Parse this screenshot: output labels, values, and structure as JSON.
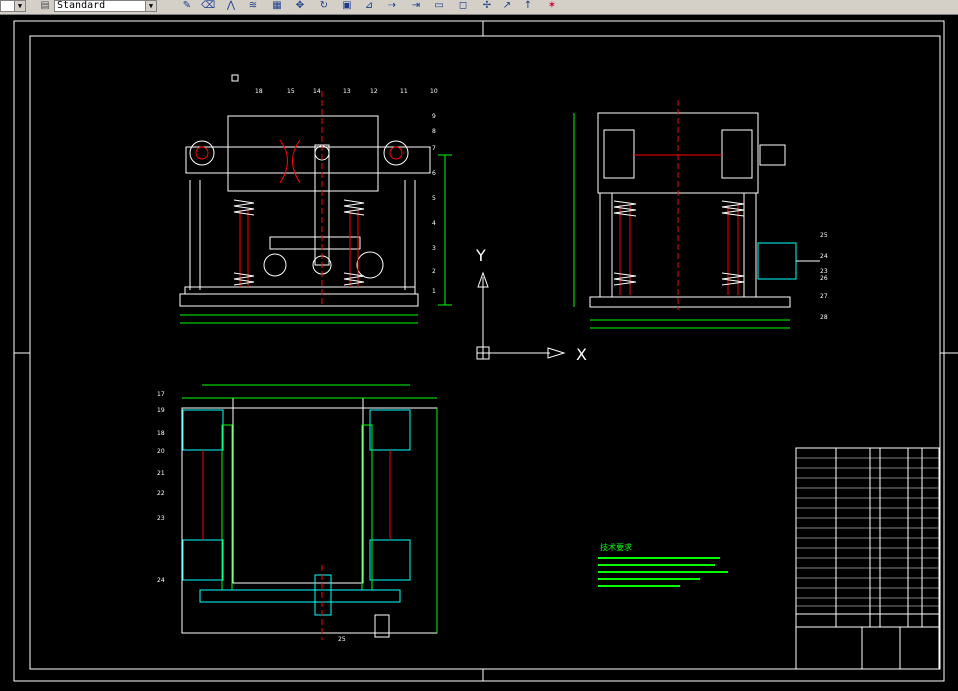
{
  "toolbar": {
    "text_style": "Standard",
    "layer_value": "",
    "icons": [
      "pencil-icon",
      "eraser-icon",
      "mirror-icon",
      "offset-icon",
      "array-icon",
      "move-icon",
      "rotate-icon",
      "scale-icon",
      "stretch-icon",
      "trim-icon",
      "extend-icon",
      "break-icon",
      "chamfer-icon",
      "fillet-icon",
      "explode-icon"
    ]
  },
  "ucs": {
    "y_label": "Y",
    "x_label": "X"
  },
  "drawing": {
    "colors": {
      "frame": "#ffffff",
      "dimension": "#00ff00",
      "center": "#ff0000",
      "part": "#ffffff",
      "hatch": "#00ffff",
      "title": "#ffff00"
    },
    "front_view_callouts": [
      "18",
      "15",
      "14",
      "13",
      "12",
      "11",
      "10",
      "9",
      "8",
      "7",
      "6",
      "5",
      "4",
      "3",
      "2",
      "1"
    ],
    "side_view_callouts": [
      "25",
      "24",
      "23",
      "26",
      "27",
      "28"
    ],
    "top_view_callouts": [
      "17",
      "19",
      "18",
      "20",
      "21",
      "22",
      "23",
      "24",
      "25"
    ],
    "tech_title": "技术要求"
  }
}
